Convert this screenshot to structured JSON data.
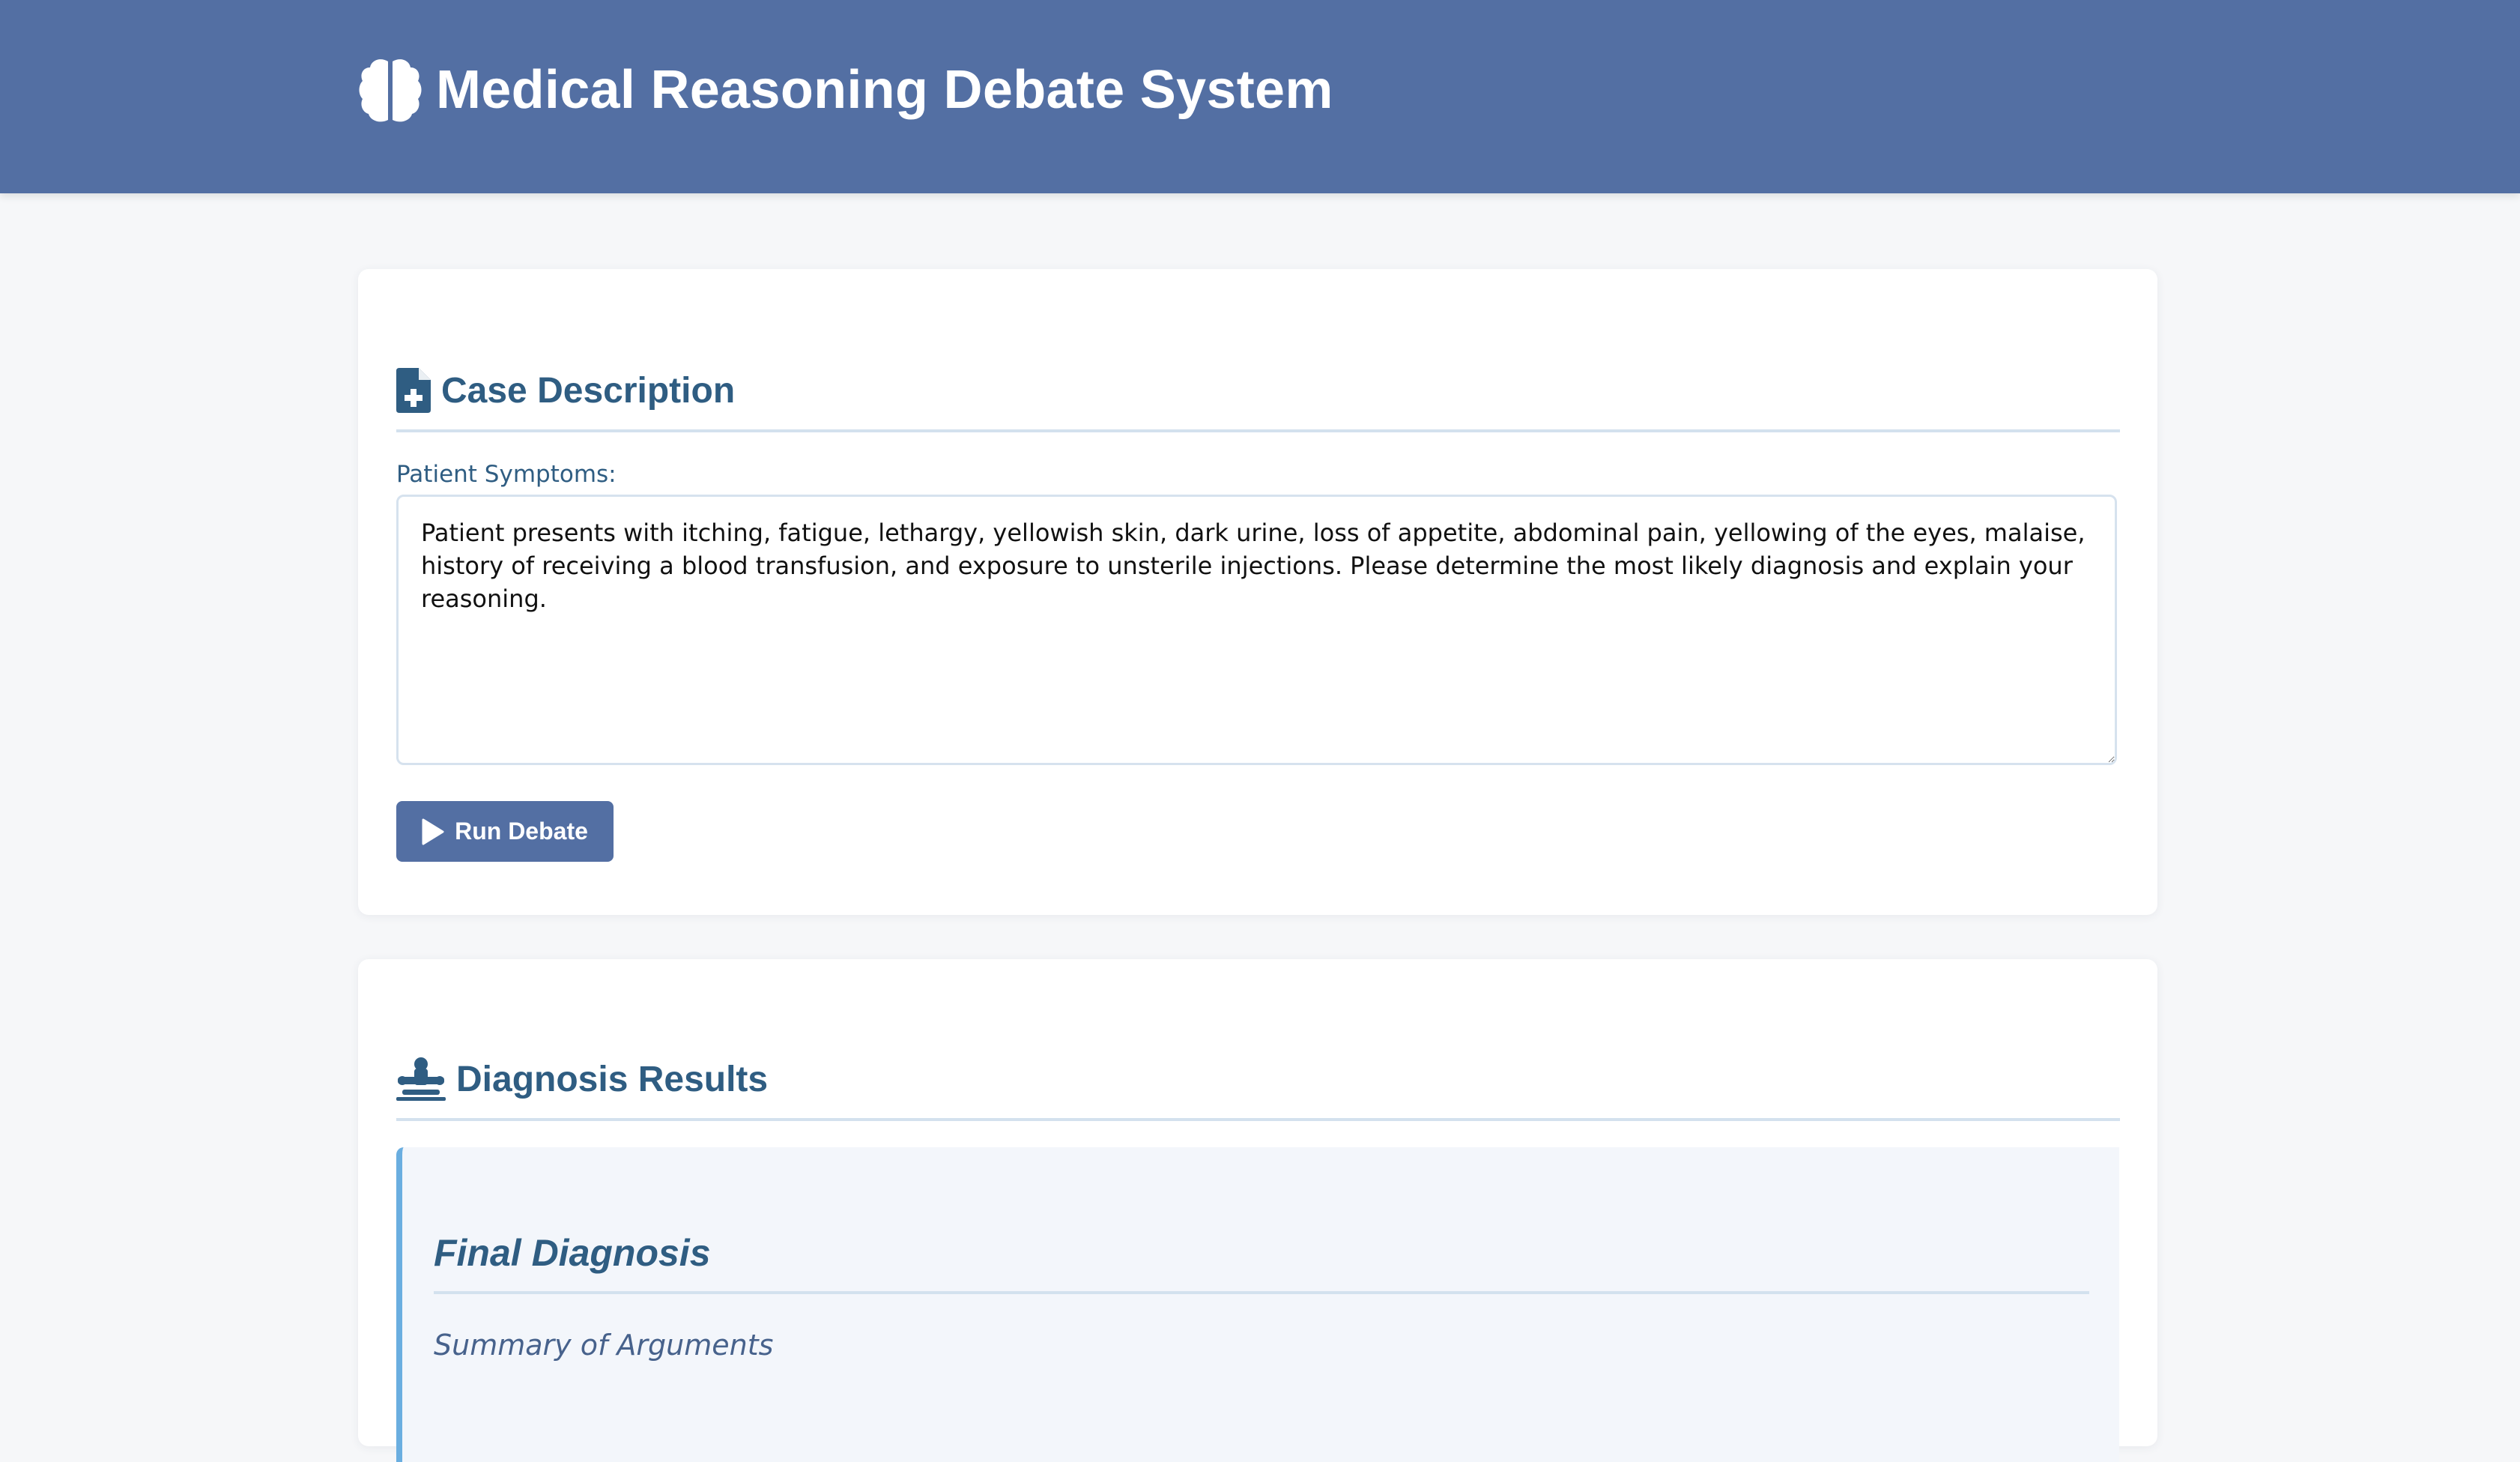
{
  "app": {
    "title": "Medical Reasoning Debate System",
    "icon": "brain-icon"
  },
  "case_section": {
    "title": "Case Description",
    "icon": "file-medical-icon",
    "symptoms_label": "Patient Symptoms:",
    "symptoms_value": "Patient presents with itching, fatigue, lethargy, yellowish skin, dark urine, loss of appetite, abdominal pain, yellowing of the eyes, malaise, history of receiving a blood transfusion, and exposure to unsterile injections. Please determine the most likely diagnosis and explain your reasoning.",
    "run_button_label": "Run Debate",
    "run_button_icon": "play-icon"
  },
  "results_section": {
    "title": "Diagnosis Results",
    "icon": "user-doctor-icon",
    "final_diagnosis_heading": "Final Diagnosis",
    "summary_heading": "Summary of Arguments"
  },
  "colors": {
    "header_bg": "#536fa3",
    "accent_text": "#2f5d82",
    "result_border": "#6aaee0",
    "page_bg": "#f6f7f9"
  }
}
